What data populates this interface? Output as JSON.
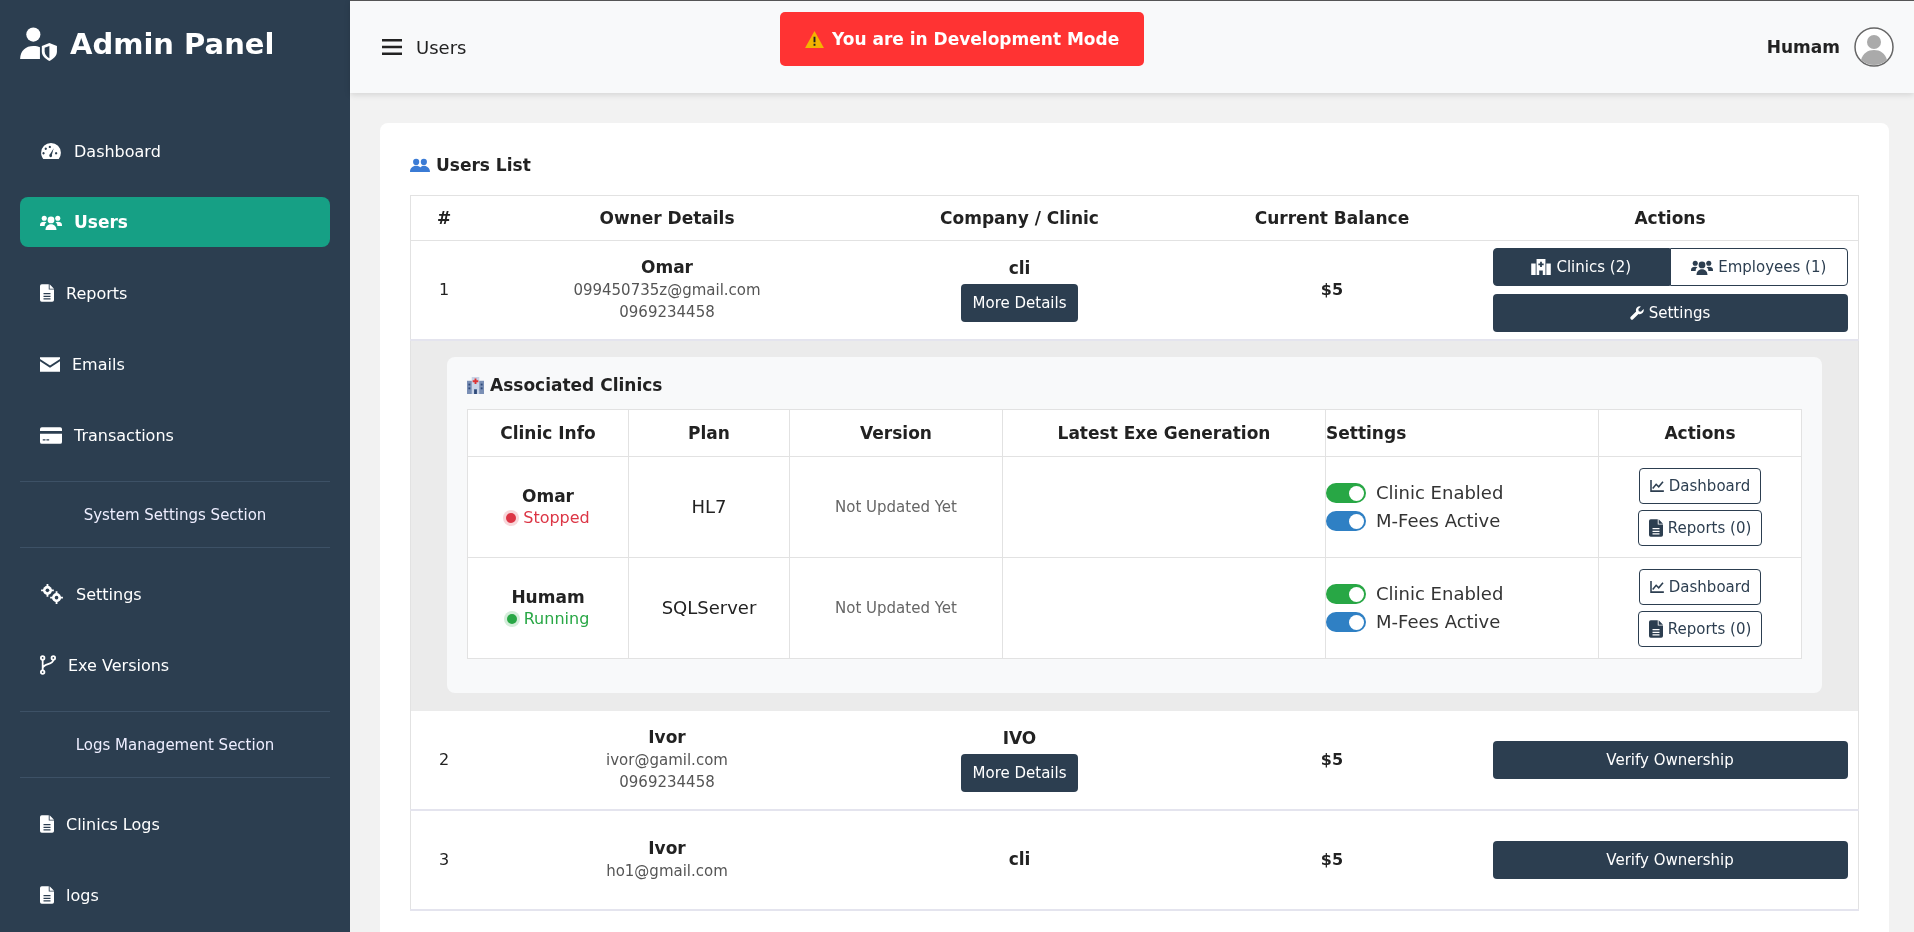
{
  "sidebar": {
    "brand": "Admin Panel",
    "items": [
      {
        "kind": "link",
        "label": "Dashboard",
        "selected": false
      },
      {
        "kind": "link",
        "label": "Users",
        "selected": true
      },
      {
        "kind": "link",
        "label": "Reports",
        "selected": false
      },
      {
        "kind": "link",
        "label": "Emails",
        "selected": false
      },
      {
        "kind": "link",
        "label": "Transactions",
        "selected": false
      },
      {
        "kind": "section",
        "label": "System Settings Section"
      },
      {
        "kind": "link",
        "label": "Settings",
        "selected": false
      },
      {
        "kind": "link",
        "label": "Exe Versions",
        "selected": false
      },
      {
        "kind": "section",
        "label": "Logs Management Section"
      },
      {
        "kind": "link",
        "label": "Clinics Logs",
        "selected": false
      },
      {
        "kind": "link",
        "label": "logs",
        "selected": false
      }
    ]
  },
  "header": {
    "page_title": "Users",
    "dev_banner": "You are in Development Mode",
    "user_name": "Humam"
  },
  "users_list": {
    "title": "Users List",
    "columns": [
      "#",
      "Owner Details",
      "Company / Clinic",
      "Current Balance",
      "Actions"
    ],
    "rows": [
      {
        "index": "1",
        "name": "Omar",
        "email": "099450735z@gmail.com",
        "phone": "0969234458",
        "company": "cli",
        "details_button": "More Details",
        "balance": "$5",
        "actions": {
          "kind": "menu",
          "tabs": [
            {
              "label": "Clinics (2)",
              "selected": true
            },
            {
              "label": "Employees (1)",
              "selected": false
            }
          ],
          "settings_button": "Settings"
        },
        "associated_clinics": {
          "title": "Associated Clinics",
          "columns": [
            "Clinic Info",
            "Plan",
            "Version",
            "Latest Exe Generation",
            "Settings",
            "Actions"
          ],
          "rows": [
            {
              "name": "Omar",
              "status": "Stopped",
              "color": "#dc3545",
              "plan": "HL7",
              "version": "Not Updated Yet",
              "settings": [
                {
                  "label": "Clinic Enabled",
                  "on": true,
                  "color": "#28a745"
                },
                {
                  "label": "M-Fees Active",
                  "on": true,
                  "color": "#2f80c4"
                }
              ],
              "actions": [
                "Dashboard",
                "Reports (0)"
              ]
            },
            {
              "name": "Humam",
              "status": "Running",
              "color": "#28a745",
              "plan": "SQLServer",
              "version": "Not Updated Yet",
              "settings": [
                {
                  "label": "Clinic Enabled",
                  "on": true,
                  "color": "#28a745"
                },
                {
                  "label": "M-Fees Active",
                  "on": true,
                  "color": "#2f80c4"
                }
              ],
              "actions": [
                "Dashboard",
                "Reports (0)"
              ]
            }
          ]
        }
      },
      {
        "index": "2",
        "name": "Ivor",
        "email": "ivor@gamil.com",
        "phone": "0969234458",
        "company": "IVO",
        "details_button": "More Details",
        "balance": "$5",
        "actions": {
          "kind": "verify",
          "label": "Verify Ownership"
        }
      },
      {
        "index": "3",
        "name": "Ivor",
        "email": "ho1@gmail.com",
        "company": "cli",
        "balance": "$5",
        "actions": {
          "kind": "verify",
          "label": "Verify Ownership"
        }
      }
    ]
  }
}
